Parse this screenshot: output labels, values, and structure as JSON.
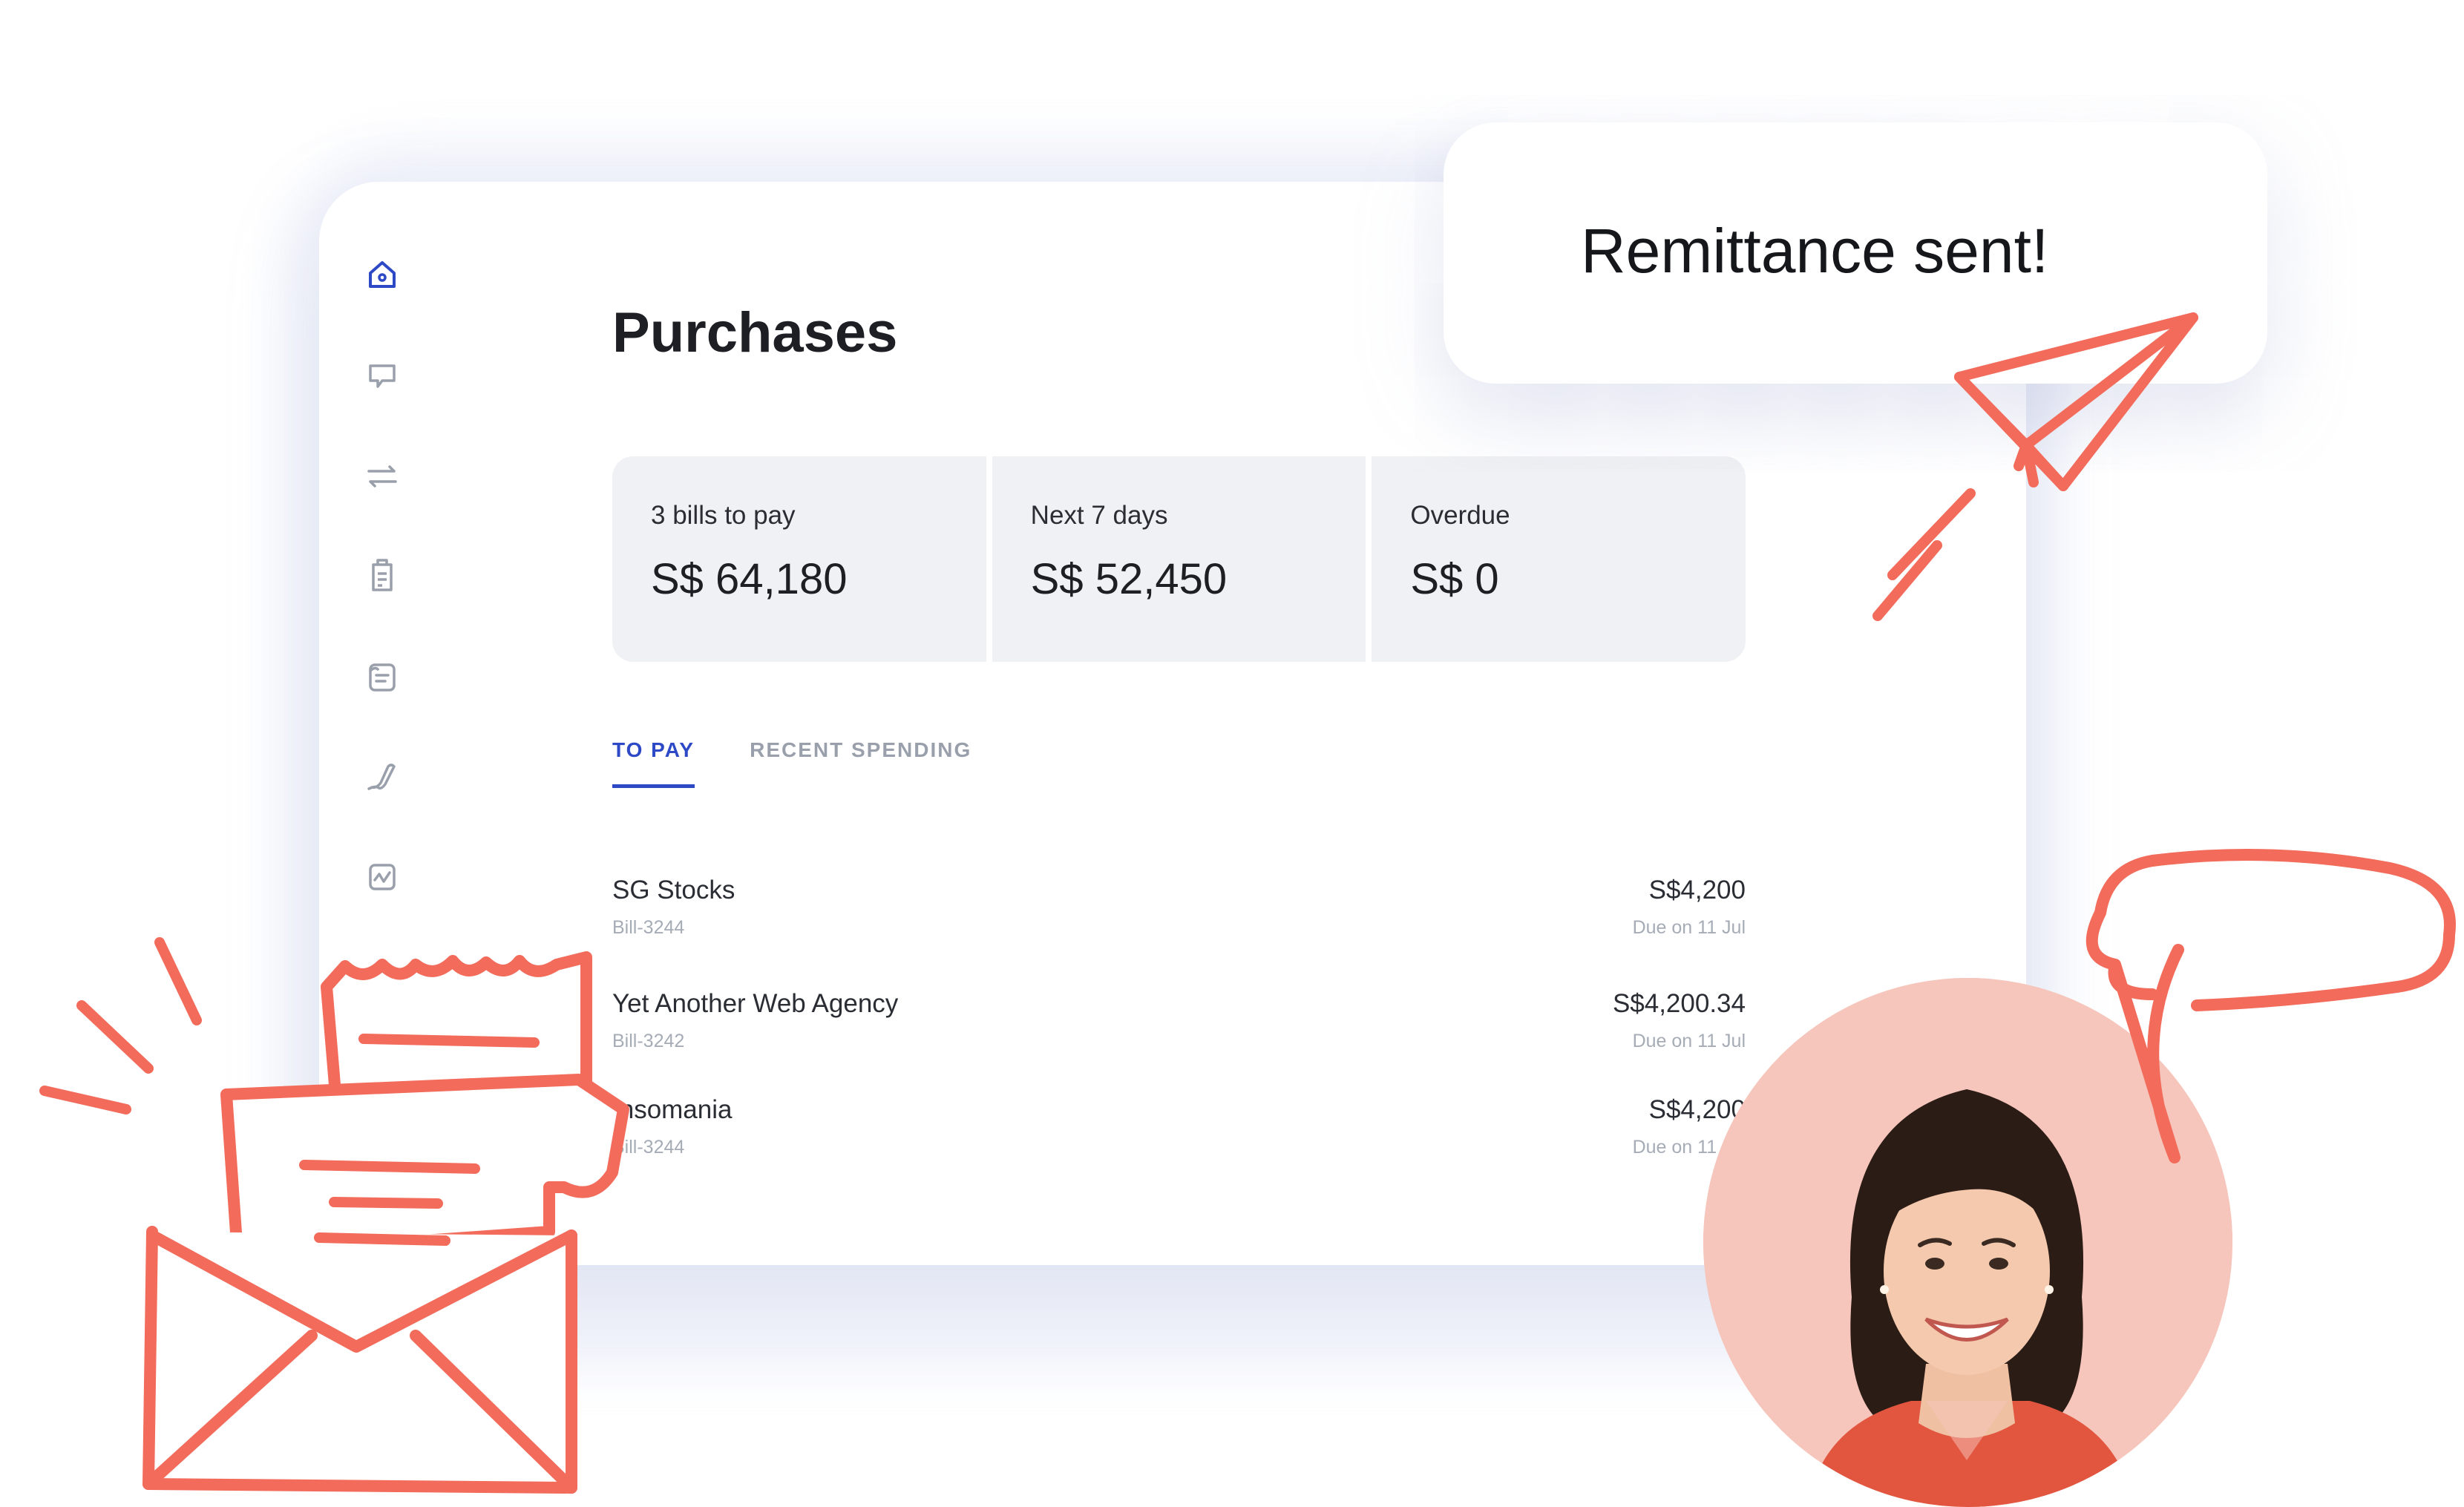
{
  "page": {
    "title": "Purchases"
  },
  "sidebar": {
    "items": [
      {
        "icon": "home-icon"
      },
      {
        "icon": "chat-icon"
      },
      {
        "icon": "transfer-icon"
      },
      {
        "icon": "receipt-icon"
      },
      {
        "icon": "document-icon"
      },
      {
        "icon": "signature-icon"
      },
      {
        "icon": "chart-icon"
      }
    ]
  },
  "stats": [
    {
      "label": "3 bills to pay",
      "value": "S$ 64,180"
    },
    {
      "label": "Next 7 days",
      "value": "S$ 52,450"
    },
    {
      "label": "Overdue",
      "value": "S$ 0"
    }
  ],
  "tabs": [
    {
      "label": "TO PAY",
      "active": true
    },
    {
      "label": "RECENT SPENDING",
      "active": false
    }
  ],
  "bills": [
    {
      "name": "SG Stocks",
      "id": "Bill-3244",
      "amount": "S$4,200",
      "due": "Due on 11 Jul"
    },
    {
      "name": "Yet Another Web Agency",
      "id": "Bill-3242",
      "amount": "S$4,200.34",
      "due": "Due on 11 Jul"
    },
    {
      "name": "Insomania",
      "id": "Bill-3244",
      "amount": "S$4,200",
      "due": "Due on 11 Jul"
    }
  ],
  "toast": {
    "message": "Remittance sent!"
  },
  "colors": {
    "accent": "#2d49c6",
    "doodle": "#f26b5b",
    "avatar_bg": "#f6c5bb"
  }
}
